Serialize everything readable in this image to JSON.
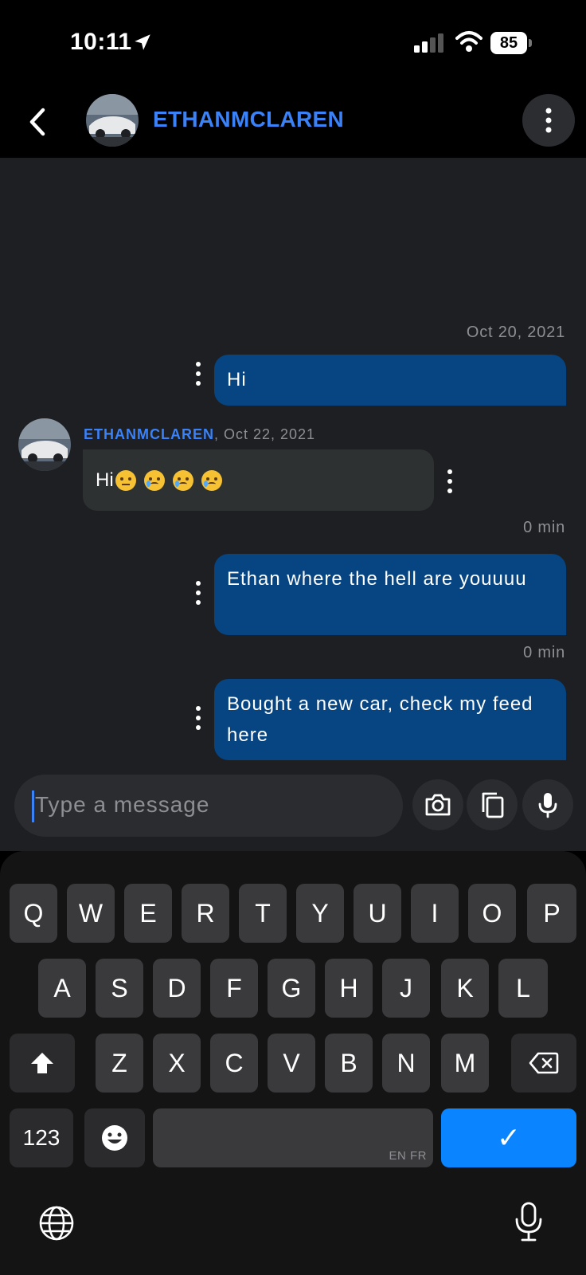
{
  "status_bar": {
    "time": "10:11",
    "battery": "85",
    "icons": [
      "location-arrow-icon",
      "cellular-signal-icon",
      "wifi-icon",
      "battery-icon"
    ]
  },
  "header": {
    "title": "ETHANMCLAREN",
    "icons": [
      "back-chevron-icon",
      "more-vertical-icon"
    ]
  },
  "colors": {
    "accent": "#3b82f6",
    "outgoing_bubble": "#064582",
    "incoming_bubble": "#2e3131",
    "chat_background": "#1e1f22",
    "keyboard_confirm": "#0a84ff"
  },
  "messages": [
    {
      "direction": "outgoing",
      "timestamp": "Oct 20, 2021",
      "text": "Hi"
    },
    {
      "direction": "incoming",
      "sender": "ETHANMCLAREN",
      "timestamp": ", Oct 22, 2021",
      "text": "Hi",
      "emojis": [
        "persevering-face",
        "crying-face",
        "crying-face",
        "crying-face"
      ]
    },
    {
      "direction": "outgoing",
      "timestamp": "0 min",
      "text": "Ethan where the hell are youuuu"
    },
    {
      "direction": "outgoing",
      "timestamp": "0 min",
      "text": "Bought a new car, check my feed here"
    }
  ],
  "composer": {
    "placeholder": "Type a message",
    "buttons": [
      "camera-icon",
      "copy-icon",
      "microphone-icon"
    ]
  },
  "keyboard": {
    "row1": [
      "Q",
      "W",
      "E",
      "R",
      "T",
      "Y",
      "U",
      "I",
      "O",
      "P"
    ],
    "row2": [
      "A",
      "S",
      "D",
      "F",
      "G",
      "H",
      "J",
      "K",
      "L"
    ],
    "row3": [
      "Z",
      "X",
      "C",
      "V",
      "B",
      "N",
      "M"
    ],
    "numbers_key": "123",
    "space_languages": "EN FR",
    "confirm_key": "✓",
    "icons": [
      "shift-icon",
      "backspace-icon",
      "emoji-icon",
      "globe-icon",
      "dictation-mic-icon"
    ]
  }
}
